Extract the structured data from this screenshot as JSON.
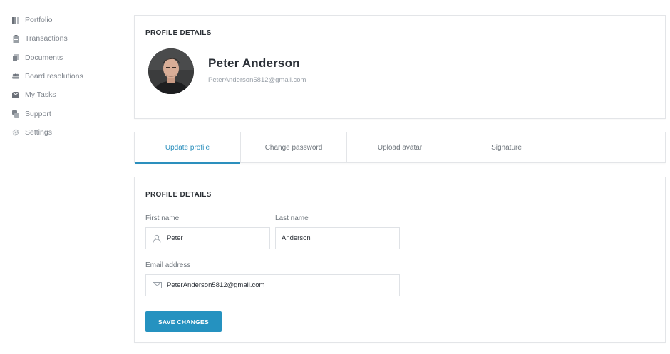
{
  "sidebar": {
    "items": [
      {
        "label": "Portfolio",
        "icon": "portfolio-icon"
      },
      {
        "label": "Transactions",
        "icon": "transactions-icon"
      },
      {
        "label": "Documents",
        "icon": "documents-icon"
      },
      {
        "label": "Board resolutions",
        "icon": "board-resolutions-icon"
      },
      {
        "label": "My Tasks",
        "icon": "tasks-icon"
      },
      {
        "label": "Support",
        "icon": "support-icon"
      },
      {
        "label": "Settings",
        "icon": "gear-icon"
      }
    ]
  },
  "profile": {
    "title": "PROFILE DETAILS",
    "name": "Peter Anderson",
    "email": "PeterAnderson5812@gmail.com"
  },
  "tabs": [
    {
      "label": "Update profile",
      "active": true
    },
    {
      "label": "Change password",
      "active": false
    },
    {
      "label": "Upload avatar",
      "active": false
    },
    {
      "label": "Signature",
      "active": false
    }
  ],
  "form": {
    "title": "PROFILE DETAILS",
    "first_name_label": "First name",
    "first_name_value": "Peter",
    "last_name_label": "Last name",
    "last_name_value": "Anderson",
    "email_label": "Email address",
    "email_value": "PeterAnderson5812@gmail.com",
    "save_label": "SAVE CHANGES"
  },
  "colors": {
    "accent": "#2592c0",
    "tab_active": "#2b8fbd",
    "muted_text": "#7d838b",
    "border": "#e3e5e8"
  }
}
